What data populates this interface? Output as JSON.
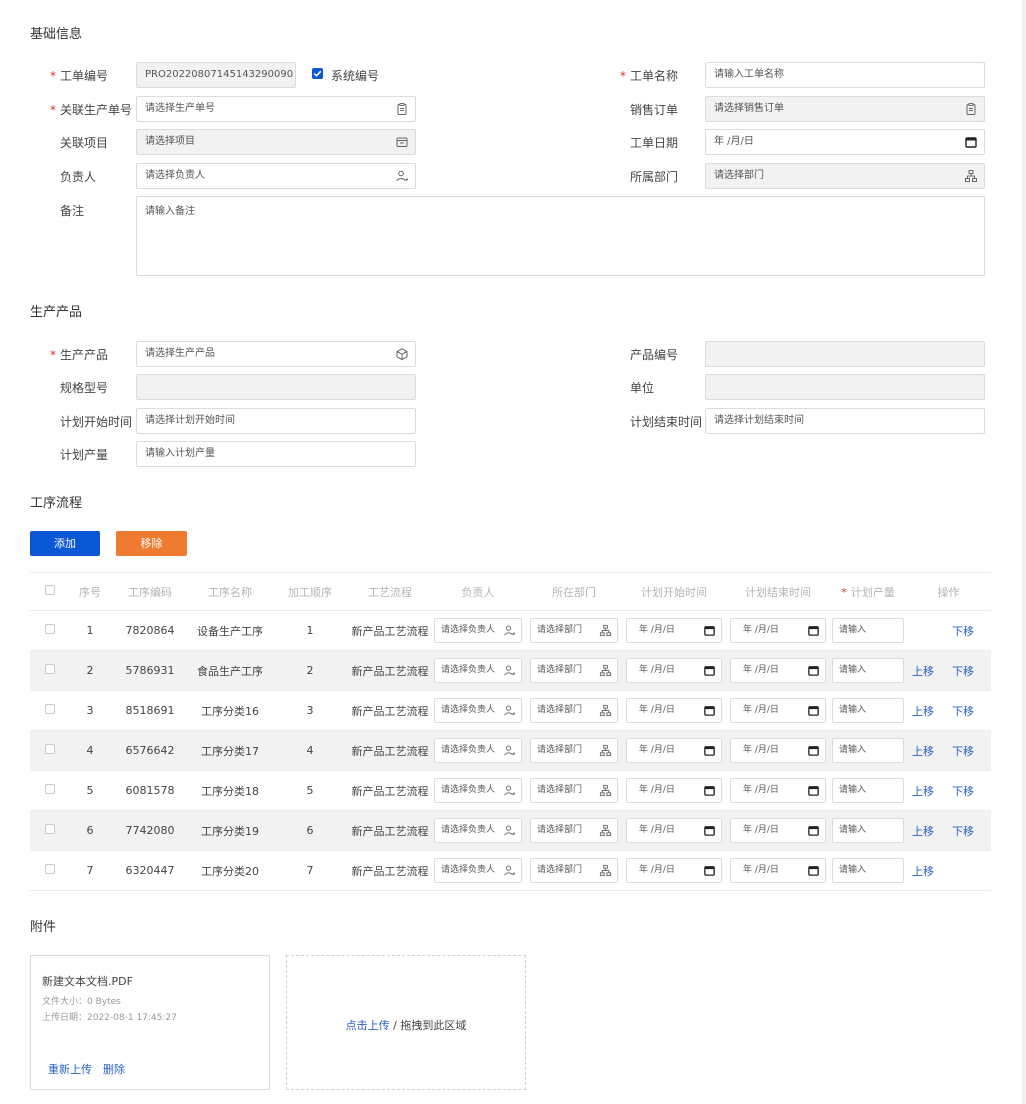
{
  "sections": {
    "basic": "基础信息",
    "product": "生产产品",
    "process": "工序流程",
    "attachment": "附件"
  },
  "basic": {
    "order_no_label": "工单编号",
    "order_no_value": "PRO20220807145143290090",
    "system_code_label": "系统编号",
    "order_name_label": "工单名称",
    "order_name_placeholder": "请输入工单名称",
    "related_prod_order_label": "关联生产单号",
    "related_prod_order_placeholder": "请选择生产单号",
    "sales_order_label": "销售订单",
    "sales_order_placeholder": "请选择销售订单",
    "related_project_label": "关联项目",
    "related_project_placeholder": "请选择项目",
    "order_date_label": "工单日期",
    "order_date_value": "年 /月/日",
    "owner_label": "负责人",
    "owner_placeholder": "请选择负责人",
    "department_label": "所属部门",
    "department_placeholder": "请选择部门",
    "remark_label": "备注",
    "remark_placeholder": "请输入备注"
  },
  "product": {
    "product_label": "生产产品",
    "product_placeholder": "请选择生产产品",
    "product_code_label": "产品编号",
    "spec_label": "规格型号",
    "unit_label": "单位",
    "plan_start_label": "计划开始时间",
    "plan_start_placeholder": "请选择计划开始时间",
    "plan_end_label": "计划结束时间",
    "plan_end_placeholder": "请选择计划结束时间",
    "plan_qty_label": "计划产量",
    "plan_qty_placeholder": "请输入计划产量"
  },
  "process": {
    "add_button": "添加",
    "remove_button": "移除",
    "headers": [
      "序号",
      "工序编码",
      "工序名称",
      "加工顺序",
      "工艺流程",
      "负责人",
      "所在部门",
      "计划开始时间",
      "计划结束时间",
      "计划产量",
      "操作"
    ],
    "owner_placeholder": "请选择负责人",
    "dept_placeholder": "请选择部门",
    "date_placeholder": "年 /月/日",
    "qty_placeholder": "请输入",
    "move_up": "上移",
    "move_down": "下移",
    "rows": [
      {
        "no": "1",
        "code": "7820864",
        "name": "设备生产工序",
        "order": "1",
        "flow": "新产品工艺流程"
      },
      {
        "no": "2",
        "code": "5786931",
        "name": "食品生产工序",
        "order": "2",
        "flow": "新产品工艺流程"
      },
      {
        "no": "3",
        "code": "8518691",
        "name": "工序分类16",
        "order": "3",
        "flow": "新产品工艺流程"
      },
      {
        "no": "4",
        "code": "6576642",
        "name": "工序分类17",
        "order": "4",
        "flow": "新产品工艺流程"
      },
      {
        "no": "5",
        "code": "6081578",
        "name": "工序分类18",
        "order": "5",
        "flow": "新产品工艺流程"
      },
      {
        "no": "6",
        "code": "7742080",
        "name": "工序分类19",
        "order": "6",
        "flow": "新产品工艺流程"
      },
      {
        "no": "7",
        "code": "6320447",
        "name": "工序分类20",
        "order": "7",
        "flow": "新产品工艺流程"
      }
    ]
  },
  "attachment": {
    "file_name": "新建文本文档.PDF",
    "file_size": "文件大小：0 Bytes",
    "upload_date": "上传日期：2022-08-1 17:45:27",
    "reupload": "重新上传",
    "delete": "删除",
    "click_upload": "点击上传",
    "drag_text": "/ 拖拽到此区域"
  },
  "colors": {
    "primary": "#0a58d6",
    "warning": "#ee7b30",
    "link": "#2a62c8",
    "required": "#e0352b"
  }
}
